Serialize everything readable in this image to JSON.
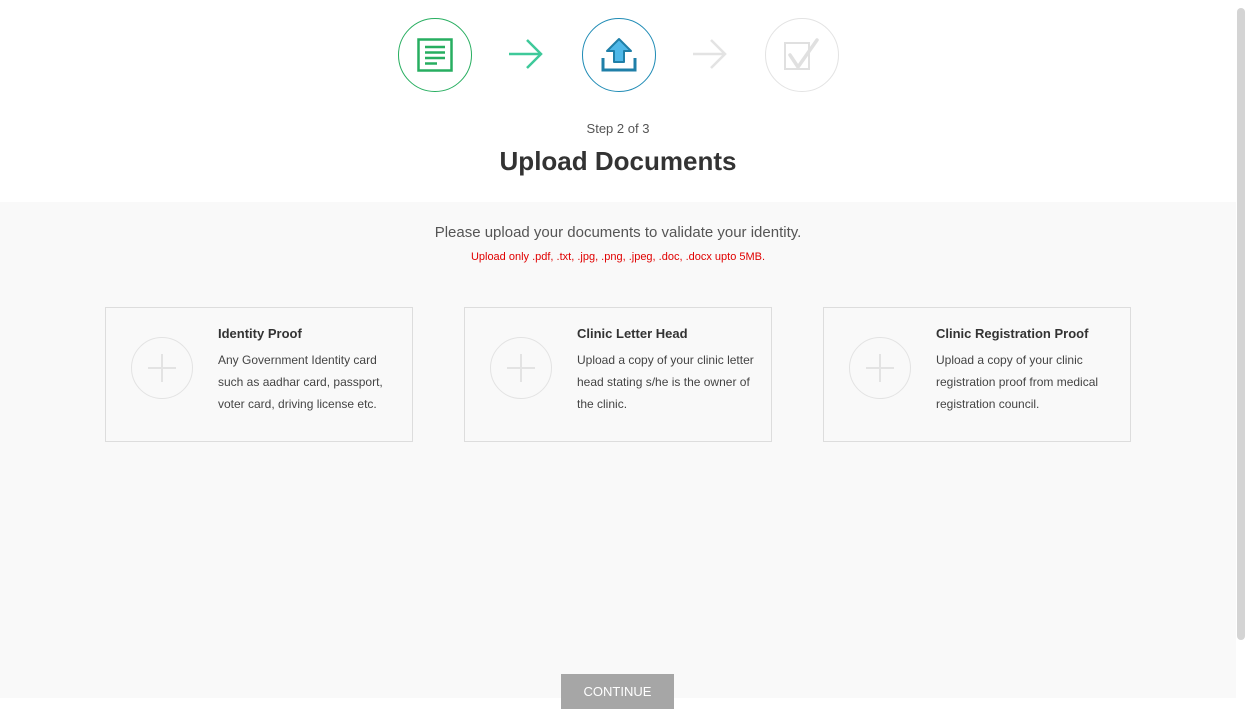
{
  "stepper": {
    "counter": "Step 2 of 3",
    "steps": [
      {
        "icon": "document-list-icon",
        "status": "completed",
        "color": "#27ae60"
      },
      {
        "icon": "upload-icon",
        "status": "active",
        "color": "#1f8bb5"
      },
      {
        "icon": "checkmark-icon",
        "status": "pending",
        "color": "#e3e3e3"
      }
    ],
    "arrows": [
      {
        "icon": "arrow-right-icon",
        "color": "#3ec99a"
      },
      {
        "icon": "arrow-right-icon",
        "color": "#e3e3e3"
      }
    ]
  },
  "page": {
    "title": "Upload Documents",
    "instructions": "Please upload your documents to validate your identity.",
    "file_note": "Upload only .pdf, .txt, .jpg, .png, .jpeg, .doc, .docx upto 5MB."
  },
  "documents": [
    {
      "title": "Identity Proof",
      "description": "Any Government Identity card such as aadhar card, passport, voter card, driving license etc.",
      "icon": "plus-icon"
    },
    {
      "title": "Clinic Letter Head",
      "description": "Upload a copy of your clinic letter head stating s/he is the owner of the clinic.",
      "icon": "plus-icon"
    },
    {
      "title": "Clinic Registration Proof",
      "description": "Upload a copy of your clinic registration proof from medical registration council.",
      "icon": "plus-icon"
    }
  ],
  "actions": {
    "continue_label": "CONTINUE"
  },
  "colors": {
    "accent_green": "#27ae60",
    "accent_blue": "#1f8bb5",
    "warning_red": "#e00000",
    "button_disabled": "#a6a6a6"
  }
}
